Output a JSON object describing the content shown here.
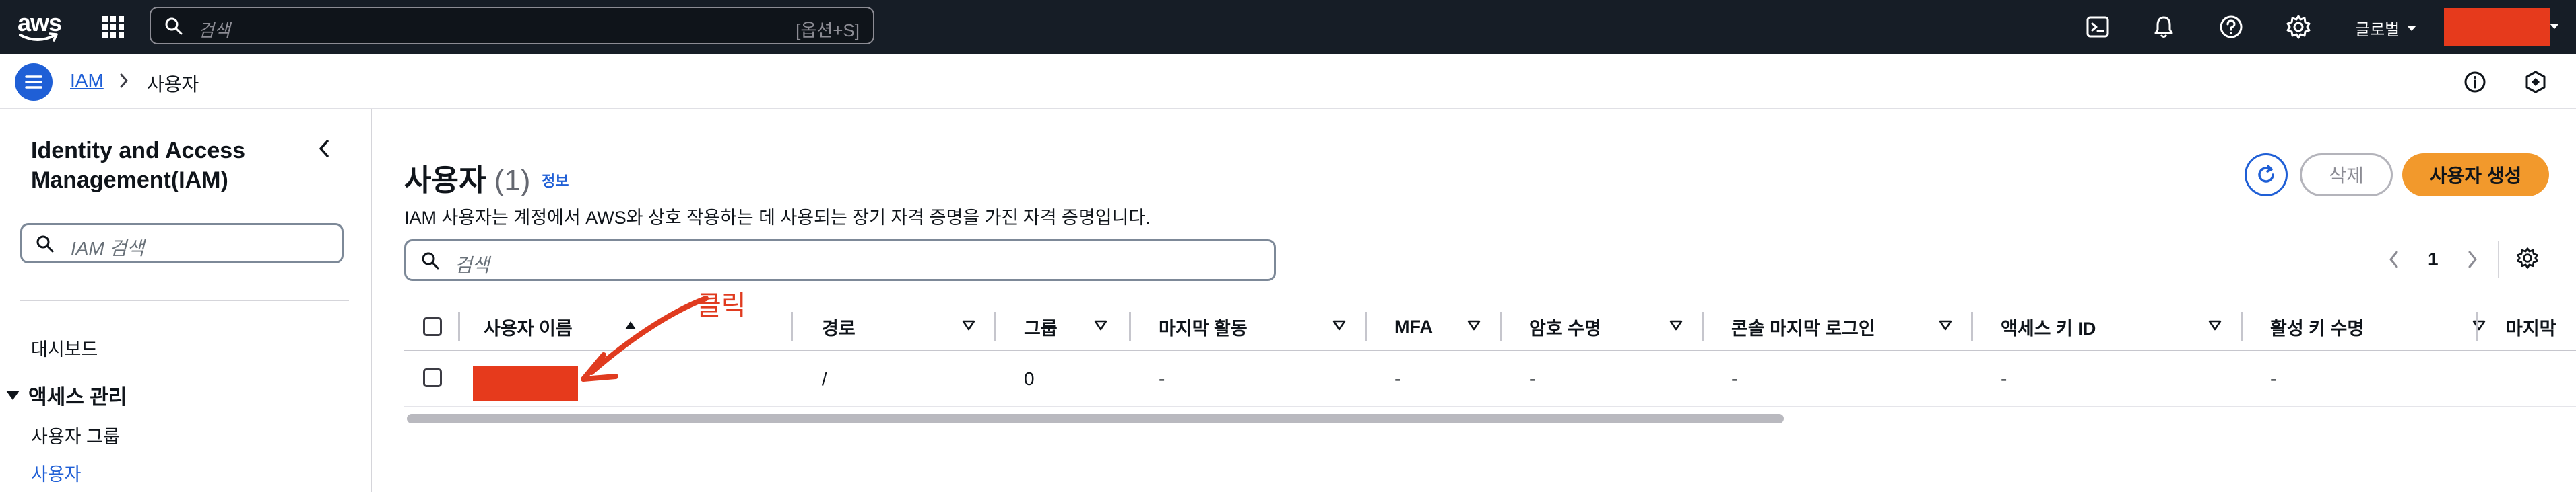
{
  "topnav": {
    "logo_text": "aws",
    "search_placeholder": "검색",
    "search_shortcut": "[옵션+S]",
    "icons": [
      "cloudshell-icon",
      "bell-icon",
      "help-icon",
      "gear-icon"
    ],
    "region_label": "글로벌",
    "account_redaction_color": "#e63a1c"
  },
  "breadcrumb": {
    "items": [
      {
        "label": "IAM",
        "link": true
      },
      {
        "label": "사용자",
        "link": false
      }
    ]
  },
  "sidebar": {
    "title": "Identity and Access Management(IAM)",
    "search_placeholder": "IAM 검색",
    "items": [
      {
        "label": "대시보드"
      }
    ],
    "section": {
      "label": "액세스 관리",
      "items": [
        {
          "label": "사용자 그룹",
          "active": false
        },
        {
          "label": "사용자",
          "active": true
        }
      ]
    }
  },
  "main": {
    "title": "사용자",
    "count": "(1)",
    "info_link": "정보",
    "description": "IAM 사용자는 계정에서 AWS와 상호 작용하는 데 사용되는 장기 자격 증명을 가진 자격 증명입니다.",
    "buttons": {
      "delete": "삭제",
      "create": "사용자 생성"
    },
    "filter_placeholder": "검색",
    "pagination": {
      "current_page": "1"
    }
  },
  "table": {
    "columns": [
      "사용자 이름",
      "경로",
      "그룹",
      "마지막 활동",
      "MFA",
      "암호 수명",
      "콘솔 마지막 로그인",
      "액세스 키 ID",
      "활성 키 수명",
      "마지막"
    ],
    "sorted_column": "사용자 이름",
    "rows": [
      {
        "user_name_redacted": true,
        "path": "/",
        "groups": "0",
        "last_activity": "-",
        "mfa": "-",
        "password_age": "-",
        "console_last_sign_in": "-",
        "access_key_id": "-",
        "active_key_age": "-"
      }
    ]
  },
  "annotation": {
    "text": "클릭",
    "color": "#e03b1f"
  },
  "colors": {
    "nav_bg": "#161d26",
    "link_blue": "#1f5fd6",
    "primary_orange": "#f2992c"
  }
}
